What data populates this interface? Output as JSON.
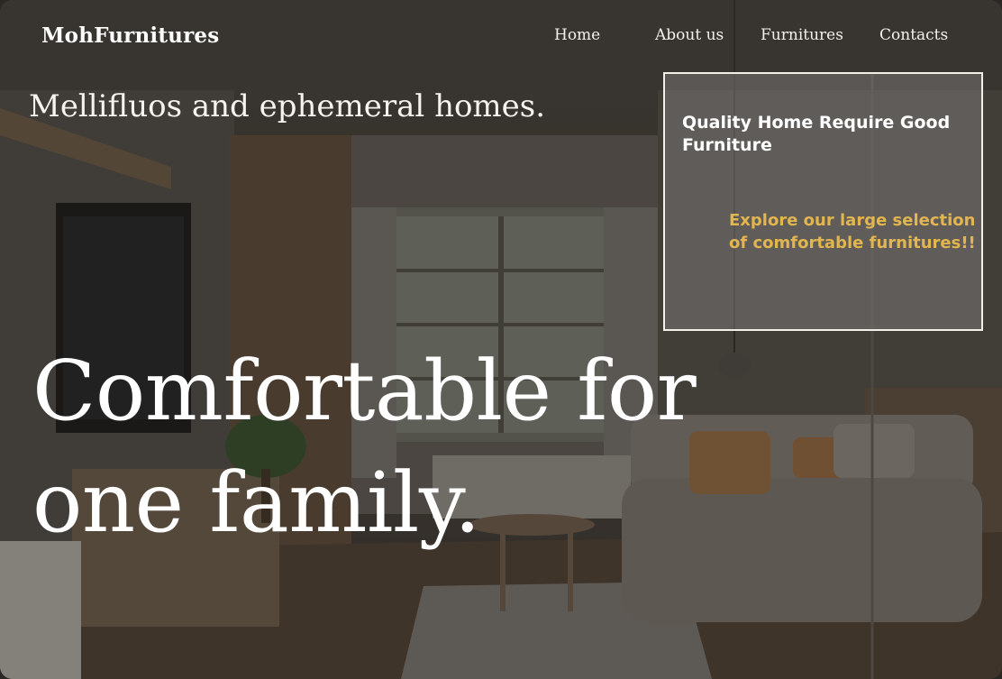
{
  "brand": {
    "name": "MohFurnitures"
  },
  "nav": {
    "items": [
      {
        "label": "Home"
      },
      {
        "label": "About us"
      },
      {
        "label": "Furnitures"
      },
      {
        "label": "Contacts"
      }
    ]
  },
  "hero": {
    "tagline": "Mellifluos and ephemeral homes.",
    "headline_line1": "Comfortable for",
    "headline_line2": "one family."
  },
  "promo_card": {
    "title": "Quality Home Require Good Furniture",
    "subtitle": "Explore our large selection of comfortable furnitures!!"
  },
  "colors": {
    "accent_yellow": "#e2b54f",
    "text_white": "#ffffff",
    "card_border": "#f2efe9"
  }
}
